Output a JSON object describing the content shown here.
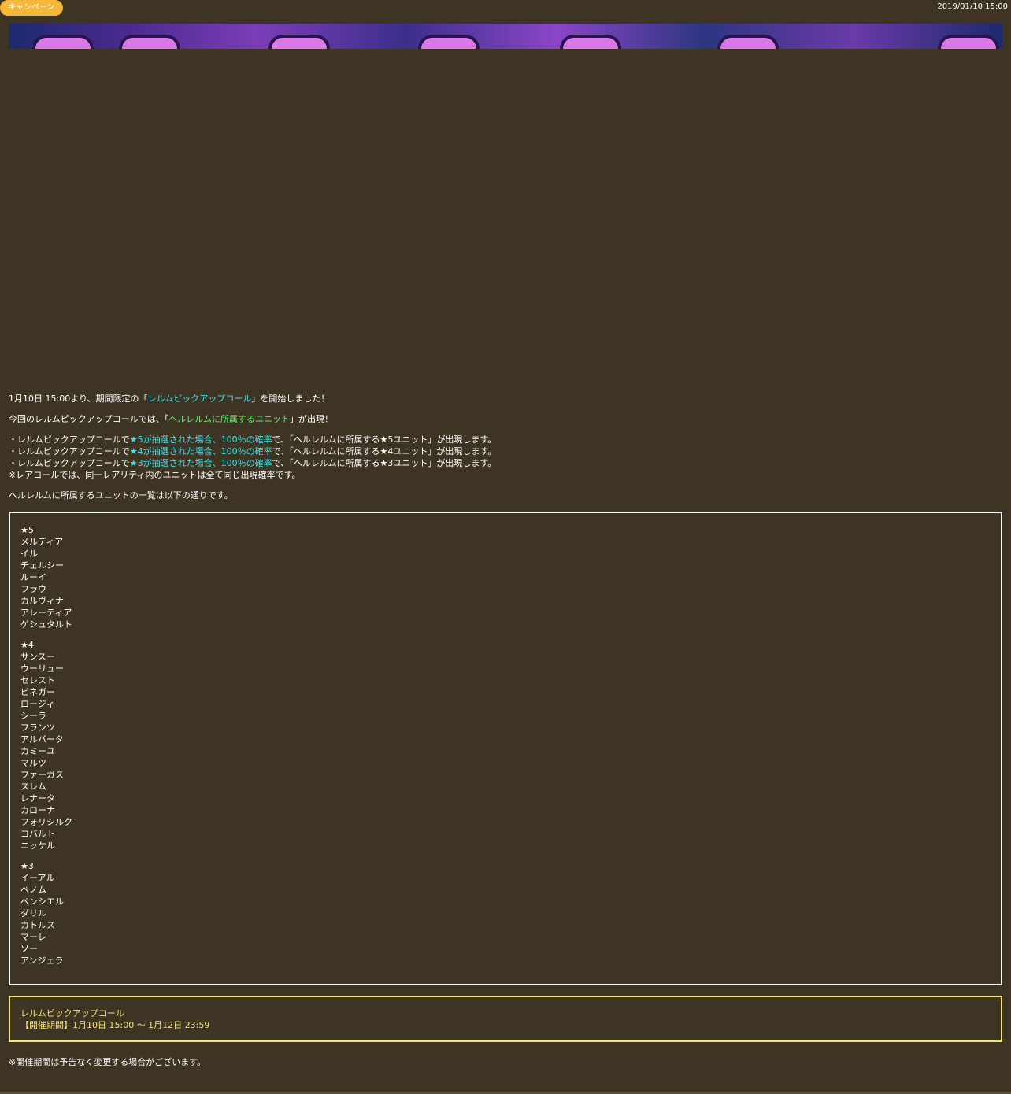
{
  "header": {
    "badge_label": "キャンペーン",
    "date": "2019/01/10 15:00"
  },
  "intro": {
    "line1_pre": "1月10日 15:00より、期間限定の「",
    "line1_link": "レルムピックアップコール",
    "line1_post": "」を開始しました！",
    "line2_pre": "今回のレルムピックアップコールでは、「",
    "line2_hl": "ヘルレルムに所属するユニット",
    "line2_post": "」が出現！"
  },
  "rules": [
    {
      "pre": "・レルムピックアップコールで",
      "hl": "★5が抽選された場合、100％の確率",
      "post": "で、「ヘルレルムに所属する★5ユニット」が出現します。"
    },
    {
      "pre": "・レルムピックアップコールで",
      "hl": "★4が抽選された場合、100％の確率",
      "post": "で、「ヘルレルムに所属する★4ユニット」が出現します。"
    },
    {
      "pre": "・レルムピックアップコールで",
      "hl": "★3が抽選された場合、100％の確率",
      "post": "で、「ヘルレルムに所属する★3ユニット」が出現します。"
    }
  ],
  "rare_note": "※レアコールでは、同一レアリティ内のユニットは全て同じ出現確率です。",
  "list_intro": "ヘルレルムに所属するユニットの一覧は以下の通りです。",
  "units": [
    {
      "rarity": "★5",
      "names": [
        "メルディア",
        "イル",
        "チェルシー",
        "ルーイ",
        "フラウ",
        "カルヴィナ",
        "アレーティア",
        "ゲシュタルト"
      ]
    },
    {
      "rarity": "★4",
      "names": [
        "サンスー",
        "ウーリュー",
        "セレスト",
        "ビネガー",
        "ロージィ",
        "シーラ",
        "フランツ",
        "アルバータ",
        "カミーユ",
        "マルツ",
        "ファーガス",
        "スレム",
        "レナータ",
        "カローナ",
        "フォリシルク",
        "コバルト",
        "ニッケル"
      ]
    },
    {
      "rarity": "★3",
      "names": [
        "イーアル",
        "ベノム",
        "ペンシエル",
        "ダリル",
        "カトルス",
        "マーレ",
        "ソー",
        "アンジェラ"
      ]
    }
  ],
  "period": {
    "title": "レルムピックアップコール",
    "dates": "【開催期間】1月10日 15:00 ～ 1月12日 23:59"
  },
  "footer_note": "※開催期間は予告なく変更する場合がございます。"
}
